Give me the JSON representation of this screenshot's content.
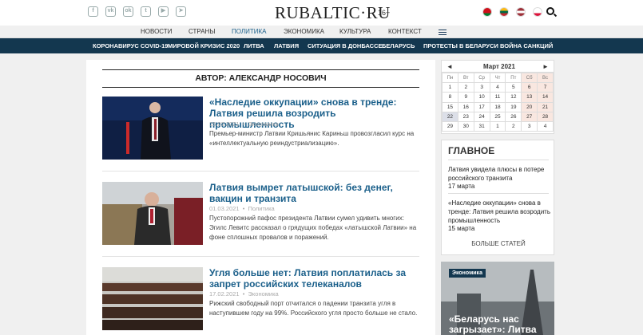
{
  "header": {
    "logo": "RUBALTIC·RU",
    "age": "16+",
    "social_icons": [
      {
        "name": "facebook-icon",
        "glyph": "f"
      },
      {
        "name": "vk-icon",
        "glyph": "vk"
      },
      {
        "name": "odnoklassniki-icon",
        "glyph": "ok"
      },
      {
        "name": "twitter-icon",
        "glyph": "t"
      },
      {
        "name": "youtube-icon",
        "glyph": "▶"
      },
      {
        "name": "telegram-icon",
        "glyph": "➤"
      }
    ],
    "flags": [
      {
        "name": "flag-belarus-icon",
        "colors": [
          "#cf101a",
          "#cf101a",
          "#007c30"
        ]
      },
      {
        "name": "flag-lithuania-icon",
        "colors": [
          "#fdb913",
          "#006a44",
          "#c1272d"
        ]
      },
      {
        "name": "flag-latvia-icon",
        "colors": [
          "#9e3039",
          "#ffffff",
          "#9e3039"
        ]
      },
      {
        "name": "flag-poland-icon",
        "colors": [
          "#ffffff",
          "#ffffff",
          "#dc143c"
        ]
      }
    ]
  },
  "nav": {
    "items": [
      "НОВОСТИ",
      "СТРАНЫ",
      "ПОЛИТИКА",
      "ЭКОНОМИКА",
      "КУЛЬТУРА",
      "КОНТЕКСТ"
    ],
    "active": "ПОЛИТИКА"
  },
  "hot_topics": [
    "КОРОНАВИРУС COVID-19",
    "МИРОВОЙ КРИЗИС 2020",
    "ЛИТВА",
    "ЛАТВИЯ",
    "СИТУАЦИЯ В ДОНБАССЕ",
    "БЕЛАРУСЬ",
    "ПРОТЕСТЫ В БЕЛАРУСИ",
    "ВОЙНА САНКЦИЙ"
  ],
  "main": {
    "author_heading": "АВТОР: АЛЕКСАНДР НОСОВИЧ",
    "articles": [
      {
        "title": "«Наследие оккупации» снова в тренде: Латвия решила возродить промышленность",
        "date": "15.03.2021",
        "category": "Экономика",
        "desc": "Премьер-министр Латвии Кришьянис Кариньш провозгласил курс на «интеллектуальную реиндустриализацию»."
      },
      {
        "title": "Латвия вымрет латышской: без денег, вакцин и транзита",
        "date": "01.03.2021",
        "category": "Политика",
        "desc": "Пустопорожний пафос президента Латвии сумел удивить многих: Эгилс Левитс рассказал о грядущих победах «латышской Латвии» на фоне сплошных провалов и поражений."
      },
      {
        "title": "Угля больше нет: Латвия поплатилась за запрет российских телеканалов",
        "date": "17.02.2021",
        "category": "Экономика",
        "desc": "Рижский свободный порт отчитался о падении транзита угля в наступившем году на 99%. Российского угля просто больше не стало."
      }
    ]
  },
  "calendar": {
    "month": "Март 2021",
    "prev": "◄",
    "next": "►",
    "dow": [
      "Пн",
      "Вт",
      "Ср",
      "Чт",
      "Пт",
      "Сб",
      "Вс"
    ],
    "weeks": [
      [
        "1",
        "2",
        "3",
        "4",
        "5",
        "6",
        "7"
      ],
      [
        "8",
        "9",
        "10",
        "11",
        "12",
        "13",
        "14"
      ],
      [
        "15",
        "16",
        "17",
        "18",
        "19",
        "20",
        "21"
      ],
      [
        "22",
        "23",
        "24",
        "25",
        "26",
        "27",
        "28"
      ],
      [
        "29",
        "30",
        "31",
        "1",
        "2",
        "3",
        "4"
      ]
    ]
  },
  "sidebar": {
    "heading": "ГЛАВНОЕ",
    "items": [
      {
        "title": "Латвия увидела плюсы в потере российского транзита",
        "date": "17 марта"
      },
      {
        "title": "«Наследие оккупации» снова в тренде: Латвия решила возродить промышленность",
        "date": "15 марта"
      }
    ],
    "more": "БОЛЬШЕ СТАТЕЙ"
  },
  "promo": {
    "tag": "Экономика",
    "title": "«Беларусь нас загрызает»: Литва"
  },
  "colors": {
    "accent": "#1a5f8a",
    "dark_bar": "#13374f",
    "weekend": "#f9e7e0"
  }
}
